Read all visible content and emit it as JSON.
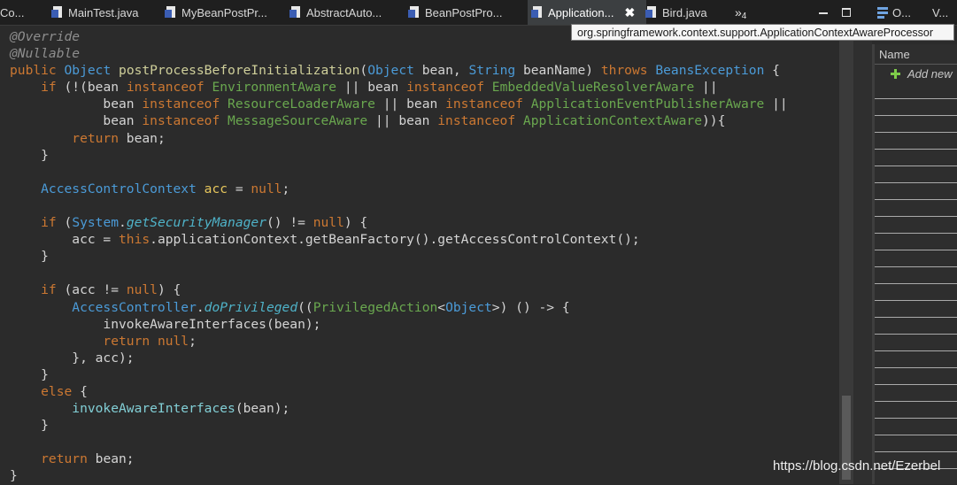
{
  "tabs": [
    {
      "label": "Co..."
    },
    {
      "label": "MainTest.java"
    },
    {
      "label": "MyBeanPostPr..."
    },
    {
      "label": "AbstractAuto..."
    },
    {
      "label": "BeanPostPro..."
    },
    {
      "label": "Application...",
      "active": true,
      "close": "✖"
    },
    {
      "label": "Bird.java"
    }
  ],
  "overflow": {
    "label": "»",
    "count": "4"
  },
  "right_tabs": {
    "first": "O...",
    "second": "V..."
  },
  "tooltip": "org.springframework.context.support.ApplicationContextAwareProcessor",
  "panel": {
    "column_header": "Name",
    "add_new": "Add new"
  },
  "watermark": "https://blog.csdn.net/Ezerbel",
  "code": {
    "lines": [
      [
        {
          "t": "@Override",
          "c": "ann"
        }
      ],
      [
        {
          "t": "@Nullable",
          "c": "ann"
        }
      ],
      [
        {
          "t": "public ",
          "c": "kw"
        },
        {
          "t": "Object ",
          "c": "ty"
        },
        {
          "t": "postProcessBeforeInitialization",
          "c": "fn"
        },
        {
          "t": "(",
          "c": ""
        },
        {
          "t": "Object ",
          "c": "ty"
        },
        {
          "t": "bean, ",
          "c": ""
        },
        {
          "t": "String ",
          "c": "ty"
        },
        {
          "t": "beanName) ",
          "c": ""
        },
        {
          "t": "throws ",
          "c": "kw"
        },
        {
          "t": "BeansException ",
          "c": "ty"
        },
        {
          "t": "{",
          "c": ""
        }
      ],
      [
        {
          "t": "    if ",
          "c": "kw"
        },
        {
          "t": "(!(bean ",
          "c": ""
        },
        {
          "t": "instanceof ",
          "c": "kw"
        },
        {
          "t": "EnvironmentAware ",
          "c": "cst"
        },
        {
          "t": "|| bean ",
          "c": ""
        },
        {
          "t": "instanceof ",
          "c": "kw"
        },
        {
          "t": "EmbeddedValueResolverAware ",
          "c": "cst"
        },
        {
          "t": "||",
          "c": ""
        }
      ],
      [
        {
          "t": "            bean ",
          "c": ""
        },
        {
          "t": "instanceof ",
          "c": "kw"
        },
        {
          "t": "ResourceLoaderAware ",
          "c": "cst"
        },
        {
          "t": "|| bean ",
          "c": ""
        },
        {
          "t": "instanceof ",
          "c": "kw"
        },
        {
          "t": "ApplicationEventPublisherAware ",
          "c": "cst"
        },
        {
          "t": "||",
          "c": ""
        }
      ],
      [
        {
          "t": "            bean ",
          "c": ""
        },
        {
          "t": "instanceof ",
          "c": "kw"
        },
        {
          "t": "MessageSourceAware ",
          "c": "cst"
        },
        {
          "t": "|| bean ",
          "c": ""
        },
        {
          "t": "instanceof ",
          "c": "kw"
        },
        {
          "t": "ApplicationContextAware",
          "c": "cst"
        },
        {
          "t": ")){",
          "c": ""
        }
      ],
      [
        {
          "t": "        return ",
          "c": "kw"
        },
        {
          "t": "bean;",
          "c": ""
        }
      ],
      [
        {
          "t": "    }",
          "c": ""
        }
      ],
      [
        {
          "t": "",
          "c": ""
        }
      ],
      [
        {
          "t": "    AccessControlContext ",
          "c": "ty"
        },
        {
          "t": "acc ",
          "c": "var"
        },
        {
          "t": "= ",
          "c": ""
        },
        {
          "t": "null",
          "c": "kw"
        },
        {
          "t": ";",
          "c": ""
        }
      ],
      [
        {
          "t": "",
          "c": ""
        }
      ],
      [
        {
          "t": "    if ",
          "c": "kw"
        },
        {
          "t": "(",
          "c": ""
        },
        {
          "t": "System",
          "c": "ty"
        },
        {
          "t": ".",
          "c": ""
        },
        {
          "t": "getSecurityManager",
          "c": "sm"
        },
        {
          "t": "() != ",
          "c": ""
        },
        {
          "t": "null",
          "c": "kw"
        },
        {
          "t": ") {",
          "c": ""
        }
      ],
      [
        {
          "t": "        acc = ",
          "c": ""
        },
        {
          "t": "this",
          "c": "kw"
        },
        {
          "t": ".applicationContext.getBeanFactory().getAccessControlContext();",
          "c": ""
        }
      ],
      [
        {
          "t": "    }",
          "c": ""
        }
      ],
      [
        {
          "t": "",
          "c": ""
        }
      ],
      [
        {
          "t": "    if ",
          "c": "kw"
        },
        {
          "t": "(acc != ",
          "c": ""
        },
        {
          "t": "null",
          "c": "kw"
        },
        {
          "t": ") {",
          "c": ""
        }
      ],
      [
        {
          "t": "        AccessController",
          "c": "ty"
        },
        {
          "t": ".",
          "c": ""
        },
        {
          "t": "doPrivileged",
          "c": "sm"
        },
        {
          "t": "((",
          "c": ""
        },
        {
          "t": "PrivilegedAction",
          "c": "cst"
        },
        {
          "t": "<",
          "c": ""
        },
        {
          "t": "Object",
          "c": "ty"
        },
        {
          "t": ">) () -> {",
          "c": ""
        }
      ],
      [
        {
          "t": "            invokeAwareInterfaces(bean);",
          "c": ""
        }
      ],
      [
        {
          "t": "            return ",
          "c": "kw"
        },
        {
          "t": "null",
          "c": "kw"
        },
        {
          "t": ";",
          "c": ""
        }
      ],
      [
        {
          "t": "        }, acc);",
          "c": ""
        }
      ],
      [
        {
          "t": "    }",
          "c": ""
        }
      ],
      [
        {
          "t": "    else ",
          "c": "kw"
        },
        {
          "t": "{",
          "c": ""
        }
      ],
      [
        {
          "t": "        invokeAwareInterfaces",
          "c": "lb"
        },
        {
          "t": "(bean);",
          "c": ""
        }
      ],
      [
        {
          "t": "    }",
          "c": ""
        }
      ],
      [
        {
          "t": "",
          "c": ""
        }
      ],
      [
        {
          "t": "    return ",
          "c": "kw"
        },
        {
          "t": "bean;",
          "c": ""
        }
      ],
      [
        {
          "t": "}",
          "c": ""
        }
      ]
    ]
  }
}
